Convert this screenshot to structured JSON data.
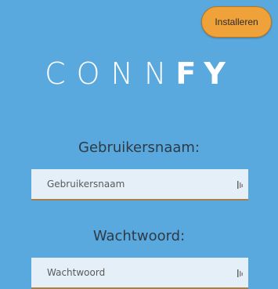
{
  "header": {
    "install_label": "Installeren"
  },
  "logo": {
    "light": "CONN",
    "bold": "FY"
  },
  "form": {
    "username": {
      "label": "Gebruikersnaam:",
      "placeholder": "Gebruikersnaam",
      "value": "",
      "icon": "autofill-icon"
    },
    "password": {
      "label": "Wachtwoord:",
      "placeholder": "Wachtwoord",
      "value": "",
      "icon": "autofill-icon"
    }
  },
  "colors": {
    "background": "#5aa9de",
    "install_button": "#f0a23a",
    "input_bg": "#e4eff7",
    "label_text": "#2e3a44"
  }
}
